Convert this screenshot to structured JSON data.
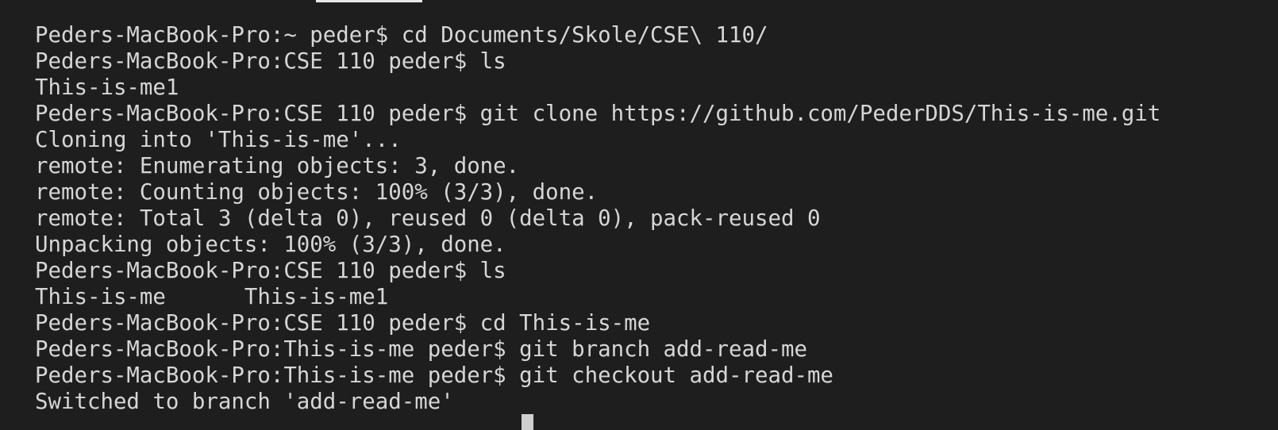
{
  "terminal": {
    "lines": [
      "Peders-MacBook-Pro:~ peder$ cd Documents/Skole/CSE\\ 110/",
      "Peders-MacBook-Pro:CSE 110 peder$ ls",
      "This-is-me1",
      "Peders-MacBook-Pro:CSE 110 peder$ git clone https://github.com/PederDDS/This-is-me.git",
      "Cloning into 'This-is-me'...",
      "remote: Enumerating objects: 3, done.",
      "remote: Counting objects: 100% (3/3), done.",
      "remote: Total 3 (delta 0), reused 0 (delta 0), pack-reused 0",
      "Unpacking objects: 100% (3/3), done.",
      "Peders-MacBook-Pro:CSE 110 peder$ ls",
      "This-is-me      This-is-me1",
      "Peders-MacBook-Pro:CSE 110 peder$ cd This-is-me",
      "Peders-MacBook-Pro:This-is-me peder$ git branch add-read-me",
      "Peders-MacBook-Pro:This-is-me peder$ git checkout add-read-me",
      "Switched to branch 'add-read-me'"
    ]
  },
  "colors": {
    "background": "#1e1e1e",
    "text": "#d6d6d6"
  }
}
